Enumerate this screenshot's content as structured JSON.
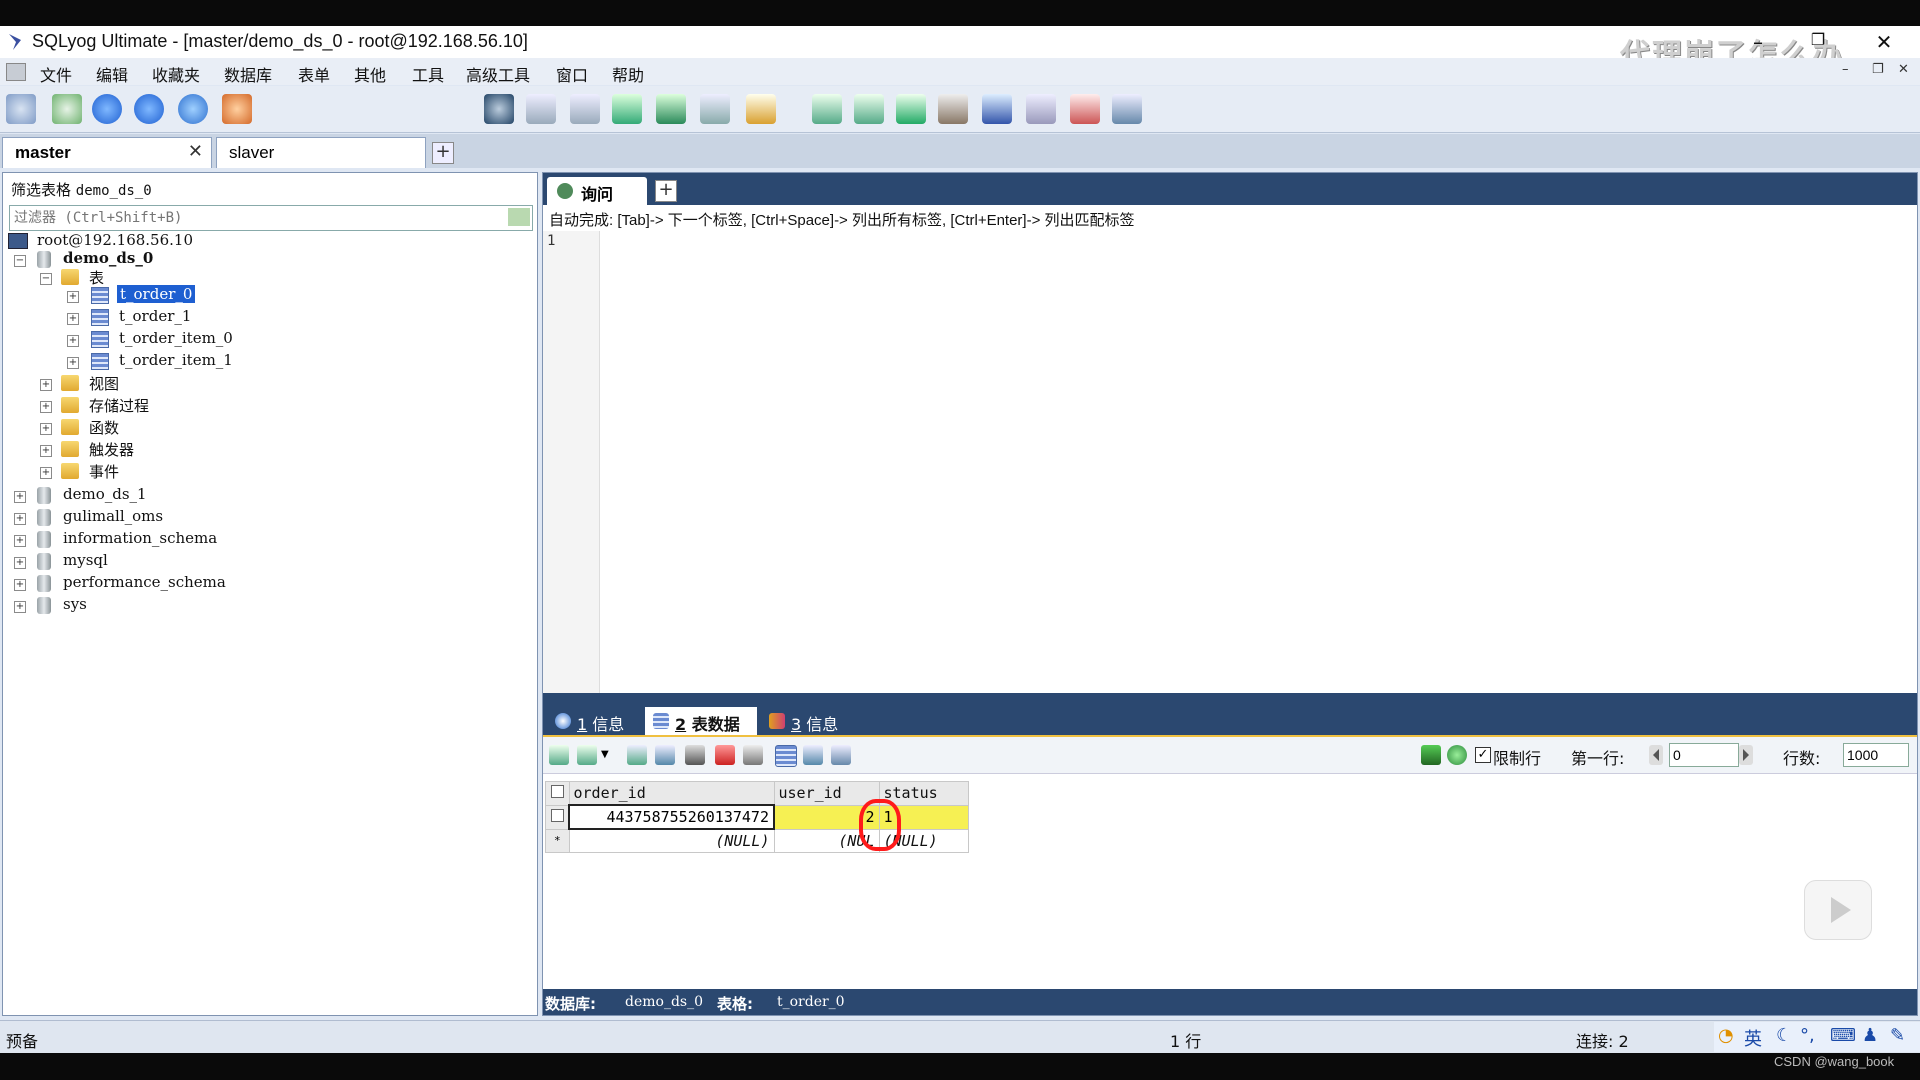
{
  "window": {
    "title": "SQLyog Ultimate - [master/demo_ds_0 - root@192.168.56.10]",
    "watermark": "代理崩了怎么办",
    "controls": {
      "minimize": "–",
      "restore": "❐",
      "close": "✕"
    },
    "mdi_controls": {
      "minimize": "–",
      "restore": "❐",
      "close": "✕"
    }
  },
  "menu": [
    "文件",
    "编辑",
    "收藏夹",
    "数据库",
    "表单",
    "其他",
    "工具",
    "高级工具",
    "窗口",
    "帮助"
  ],
  "toolbar": {
    "database_selector": "demo_ds_0",
    "icons": [
      "new-connection-icon",
      "new-query-icon",
      "execute-icon",
      "execute-all-icon",
      "refresh-icon",
      "users-icon",
      "user-manager-icon",
      "backup-icon",
      "restore-icon",
      "import-icon",
      "export-icon",
      "sync-icon",
      "schema-icon",
      "table-icon",
      "index-icon",
      "tools-icon",
      "schedule-icon",
      "transfer-icon",
      "copy-db-icon",
      "monitor-icon",
      "report-icon",
      "layout-icon"
    ]
  },
  "connection_tabs": [
    {
      "label": "master",
      "active": true,
      "close": "✕"
    },
    {
      "label": "slaver",
      "active": false
    }
  ],
  "add_tab_symbol": "+",
  "object_browser": {
    "filter_label": "筛选表格",
    "filter_db": "demo_ds_0",
    "filter_placeholder": "过滤器 (Ctrl+Shift+B)",
    "tree": {
      "server": "root@192.168.56.10",
      "active_db": "demo_ds_0",
      "tables_folder": "表",
      "tables": [
        "t_order_0",
        "t_order_1",
        "t_order_item_0",
        "t_order_item_1"
      ],
      "selected_table": "t_order_0",
      "folders": [
        "视图",
        "存储过程",
        "函数",
        "触发器",
        "事件"
      ],
      "other_dbs": [
        "demo_ds_1",
        "gulimall_oms",
        "information_schema",
        "mysql",
        "performance_schema",
        "sys"
      ]
    }
  },
  "query": {
    "tab_label": "询问",
    "add_symbol": "+",
    "autocomplete_hint": "自动完成: [Tab]-> 下一个标签, [Ctrl+Space]-> 列出所有标签, [Ctrl+Enter]-> 列出匹配标签",
    "line_number": "1"
  },
  "result_tabs": [
    {
      "num": "1",
      "label": "信息",
      "active": false
    },
    {
      "num": "2",
      "label": "表数据",
      "active": true
    },
    {
      "num": "3",
      "label": "信息",
      "active": false
    }
  ],
  "grid_toolbar": {
    "limit_label": "限制行",
    "limit_checked": true,
    "first_row_label": "第一行:",
    "first_row_value": "0",
    "rows_label": "行数:",
    "rows_value": "1000"
  },
  "grid": {
    "columns": [
      "order_id",
      "user_id",
      "status"
    ],
    "rows": [
      [
        "443758755260137472",
        "2",
        "1"
      ]
    ],
    "new_row_marker": "*",
    "null_text": "(NULL)",
    "null_text_truncated": "(NUL"
  },
  "result_status": {
    "db_label": "数据库:",
    "db_value": "demo_ds_0",
    "table_label": "表格:",
    "table_value": "t_order_0"
  },
  "statusbar": {
    "left": "预备",
    "rows": "1 行",
    "connections": "连接: 2"
  },
  "ime": {
    "mode": "英"
  },
  "footer_credit": "CSDN @wang_book",
  "colors": {
    "accent": "#2b4870",
    "selection": "#1e5fd1",
    "highlight": "#f6f053",
    "annotation": "#ff1a1a"
  }
}
